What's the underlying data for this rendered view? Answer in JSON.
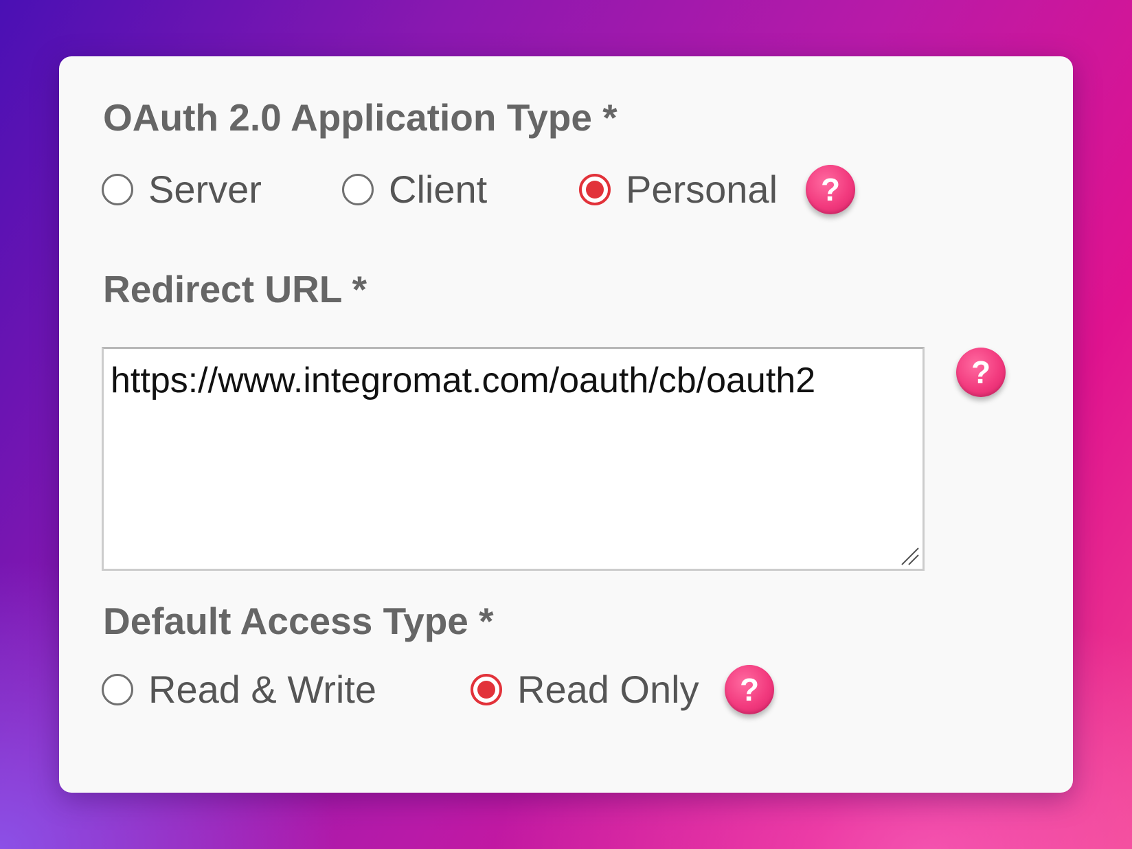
{
  "application_type": {
    "label": "OAuth 2.0 Application Type *",
    "options": [
      {
        "label": "Server",
        "checked": false
      },
      {
        "label": "Client",
        "checked": false
      },
      {
        "label": "Personal",
        "checked": true
      }
    ],
    "help_symbol": "?"
  },
  "redirect_url": {
    "label": "Redirect URL *",
    "value": "https://www.integromat.com/oauth/cb/oauth2",
    "help_symbol": "?"
  },
  "access_type": {
    "label": "Default Access Type *",
    "options": [
      {
        "label": "Read & Write",
        "checked": false
      },
      {
        "label": "Read Only",
        "checked": true
      }
    ],
    "help_symbol": "?"
  },
  "icons": {
    "help": "question-mark-icon",
    "resize": "resize-grip-icon"
  },
  "colors": {
    "accent": "#e2323a",
    "help_badge": "#f23a7e",
    "label_text": "#666666",
    "card_background": "#f9f9f9"
  }
}
